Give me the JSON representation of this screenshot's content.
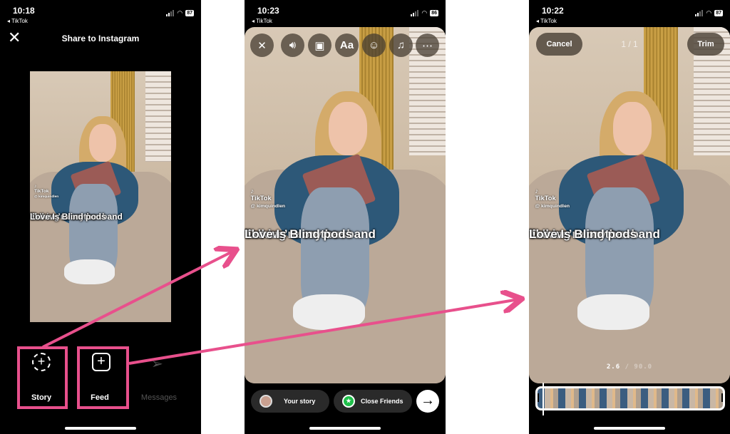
{
  "panel1": {
    "time": "10:18",
    "back_app": "TikTok",
    "battery": "87",
    "title": "Share to Instagram",
    "caption": [
      "Talking to my husband",
      "like we’re on the",
      "Love Is Blind pods"
    ],
    "watermark": "TikTok",
    "handle": "@ kimquindlen",
    "options": [
      {
        "label": "Story",
        "icon": "story-add-icon"
      },
      {
        "label": "Feed",
        "icon": "feed-add-icon"
      },
      {
        "label": "Messages",
        "icon": "send-icon"
      }
    ]
  },
  "panel2": {
    "time": "10:23",
    "back_app": "TikTok",
    "battery": "86",
    "tools": [
      "close-icon",
      "sound-icon",
      "mention-icon",
      "text-icon",
      "sticker-icon",
      "music-icon",
      "more-icon"
    ],
    "text_tool": "Aa",
    "caption": [
      "Talking to my husband",
      "like we’re on the",
      "Love Is Blind pods"
    ],
    "watermark": "TikTok",
    "handle": "@ kimquindlen",
    "your_story": "Your story",
    "close_friends": "Close Friends"
  },
  "panel3": {
    "time": "10:22",
    "back_app": "TikTok",
    "battery": "87",
    "cancel": "Cancel",
    "counter": "1 / 1",
    "trim": "Trim",
    "caption": [
      "Talking to my husband",
      "like we’re on the",
      "Love Is Blind pods"
    ],
    "watermark": "TikTok",
    "handle": "@ kimquindlen",
    "position": "2.6",
    "duration": "90.0"
  },
  "colors": {
    "annotation": "#e8508c",
    "close_friends": "#1fbf4a"
  }
}
